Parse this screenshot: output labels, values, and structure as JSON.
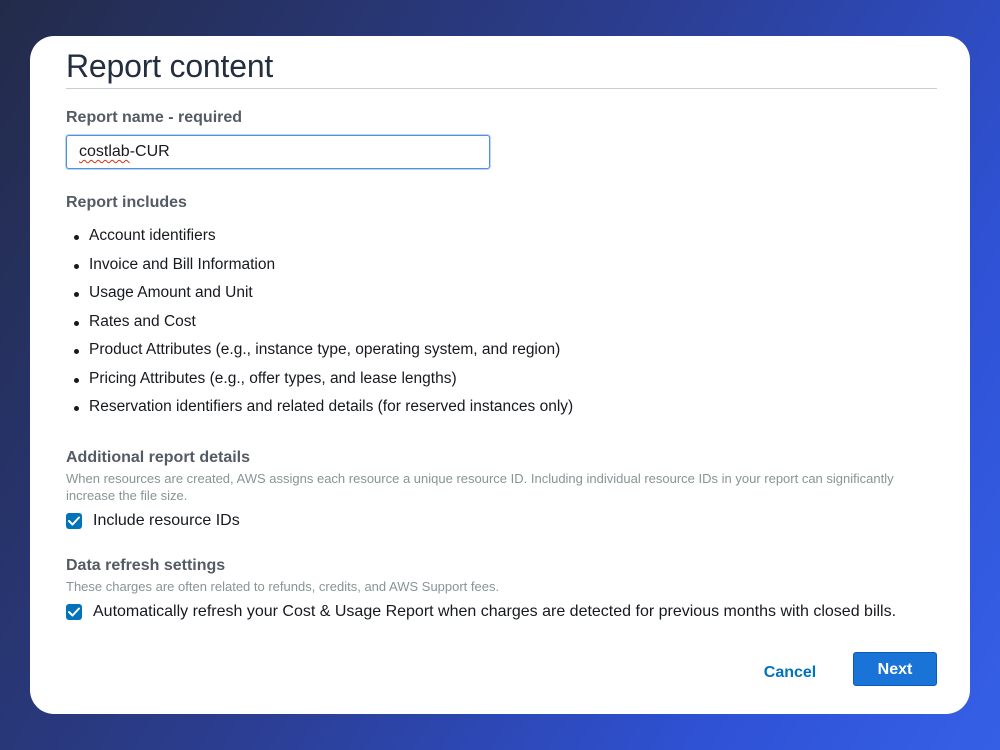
{
  "page": {
    "title": "Report content"
  },
  "report_name": {
    "label": "Report name - required",
    "value_underlined": "costlab",
    "value_rest": "-CUR"
  },
  "report_includes": {
    "heading": "Report includes",
    "items": [
      "Account identifiers",
      "Invoice and Bill Information",
      "Usage Amount and Unit",
      "Rates and Cost",
      "Product Attributes (e.g., instance type, operating system, and region)",
      "Pricing Attributes (e.g., offer types, and lease lengths)",
      "Reservation identifiers and related details (for reserved instances only)"
    ]
  },
  "additional_details": {
    "heading": "Additional report details",
    "description": "When resources are created, AWS assigns each resource a unique resource ID. Including individual resource IDs in your report can significantly increase the file size.",
    "checkbox_label": "Include resource IDs",
    "checked": true
  },
  "data_refresh": {
    "heading": "Data refresh settings",
    "description": "These charges are often related to refunds, credits, and AWS Support fees.",
    "checkbox_label": "Automatically refresh your Cost & Usage Report when charges are detected for previous months with closed bills.",
    "checked": true
  },
  "actions": {
    "cancel_label": "Cancel",
    "next_label": "Next"
  },
  "colors": {
    "primary": "#0073bb",
    "next_button": "#1a73d6"
  }
}
